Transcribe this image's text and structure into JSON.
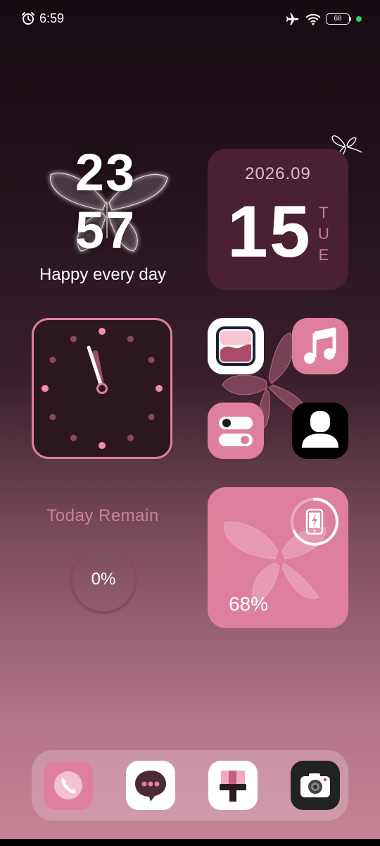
{
  "status_bar": {
    "time": "6:59",
    "battery": "68"
  },
  "clock_widget": {
    "hour": "23",
    "minute": "57",
    "caption": "Happy every day"
  },
  "date_widget": {
    "year_month": "2026.09",
    "day": "15",
    "weekday": [
      "T",
      "U",
      "E"
    ]
  },
  "analog_clock": {
    "hour_hand_deg": 349,
    "minute_hand_deg": 342
  },
  "apps": [
    {
      "icon": "gallery-icon"
    },
    {
      "icon": "music-icon"
    },
    {
      "icon": "settings-toggle-icon"
    },
    {
      "icon": "contacts-icon"
    }
  ],
  "today_remain": {
    "title": "Today Remain",
    "value": "0%",
    "progress": 0
  },
  "battery_widget": {
    "value": "68%",
    "progress": 0.68
  },
  "dock": [
    {
      "icon": "phone-icon"
    },
    {
      "icon": "messages-icon"
    },
    {
      "icon": "theme-brush-icon"
    },
    {
      "icon": "camera-icon"
    }
  ],
  "colors": {
    "accent_pink": "#de809d",
    "date_widget_bg": "#4a2132",
    "clock_widget_bg": "#2c1721",
    "dock_bg": "rgba(235,200,212,0.35)"
  }
}
